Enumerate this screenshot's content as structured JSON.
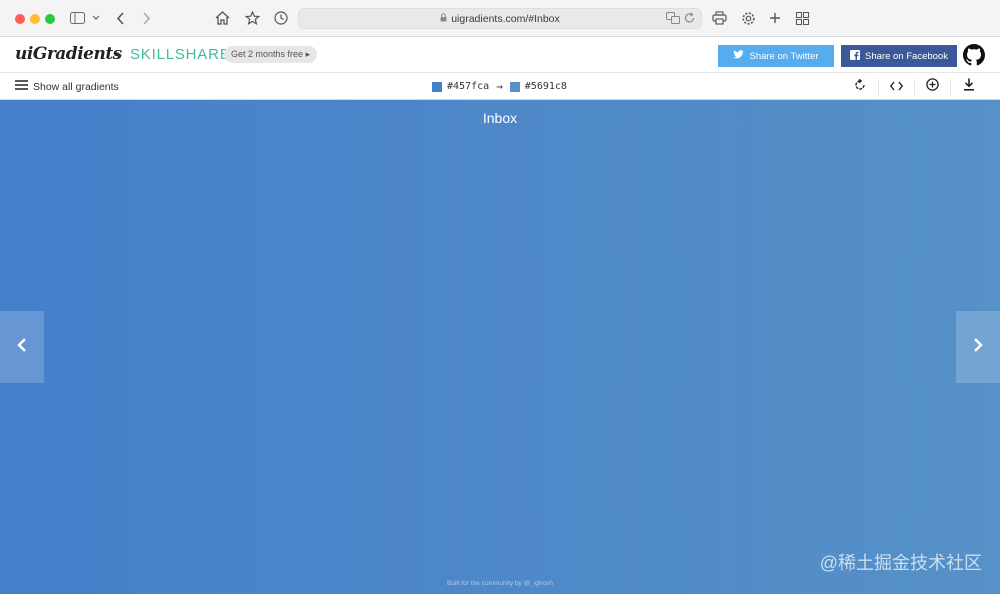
{
  "browser": {
    "url": "uigradients.com/#Inbox"
  },
  "header": {
    "logo": "uiGradients",
    "plus": "+",
    "partner": "SKILLSHARE",
    "promo": "Get 2 months free",
    "twitter_label": "Share on Twitter",
    "facebook_label": "Share on Facebook"
  },
  "toolbar": {
    "show_all": "Show all gradients",
    "color_from": "#457fca",
    "color_to": "#5691c8",
    "arrow": "→"
  },
  "gradient": {
    "name": "Inbox",
    "credit": "Built for the community by @_ighosh"
  },
  "watermark": "@稀土掘金技术社区",
  "colors": {
    "gradient_start": "#457fca",
    "gradient_end": "#5691c8",
    "twitter": "#55acee",
    "facebook": "#3b5998",
    "skillshare": "#3dbc9e"
  }
}
